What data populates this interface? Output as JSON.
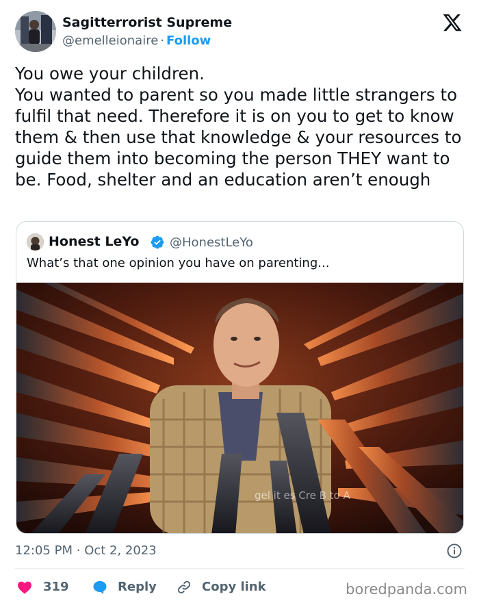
{
  "author": {
    "display_name": "Sagitterrorist Supreme",
    "handle": "@emelleionaire",
    "separator": "·",
    "follow_label": "Follow",
    "avatar_icon": "user-avatar"
  },
  "brand_icon": "x-logo-icon",
  "tweet": {
    "text": "You owe your children.\nYou wanted to parent so you made little strangers to fulfil that need. Therefore it is on you to get to know them & then use that knowledge & your resources to guide them into becoming the person THEY want to be. Food, shelter and an education aren’t enough"
  },
  "quoted_tweet": {
    "display_name": "Honest LeYo",
    "handle": "@HonestLeYo",
    "verified_icon": "verified-badge-icon",
    "text": "What’s that one opinion you have on parenting...",
    "media_watermark": "gel it es Cre B to A"
  },
  "meta": {
    "time": "12:05 PM",
    "separator": "·",
    "date": "Oct 2, 2023",
    "info_icon": "info-icon"
  },
  "actions": {
    "likes": "319",
    "reply_label": "Reply",
    "copy_link_label": "Copy link"
  },
  "watermark": "boredpanda.com",
  "colors": {
    "accent": "#1d9bf0",
    "like": "#f91880",
    "text": "#0f1419",
    "muted": "#536471",
    "border": "#cfd9de"
  }
}
